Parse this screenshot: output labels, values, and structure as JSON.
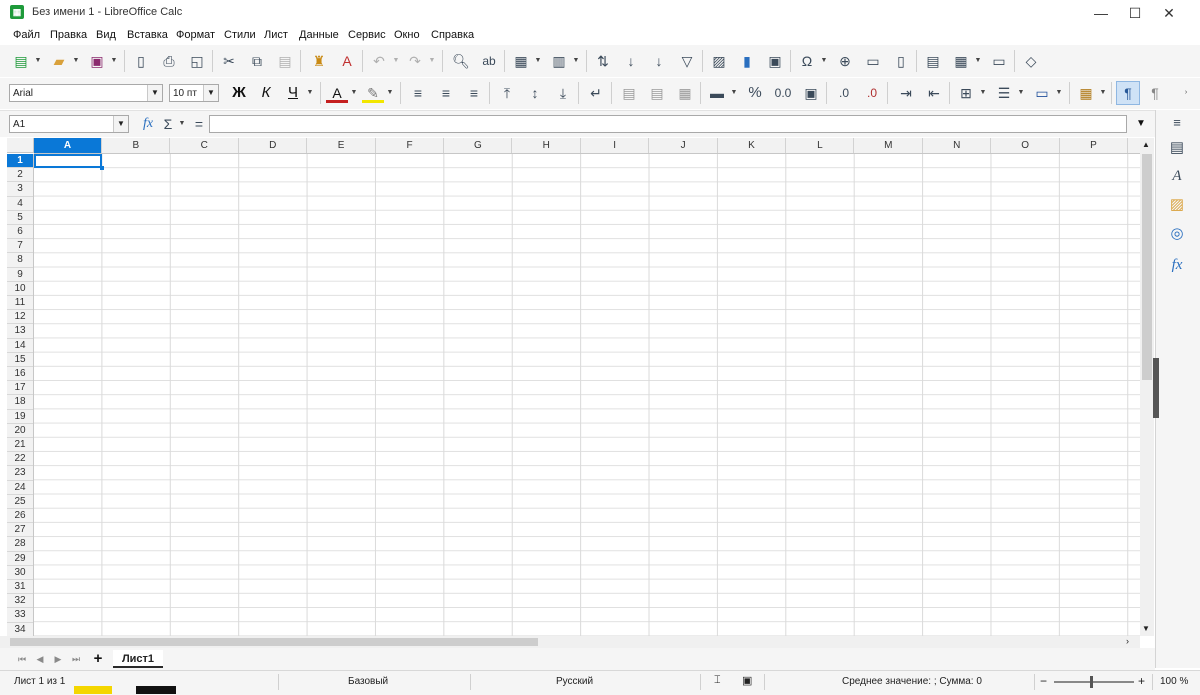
{
  "window": {
    "title": "Без имени 1 - LibreOffice Calc",
    "app_icon": "calc-icon",
    "controls": [
      "minimize-icon",
      "maximize-icon",
      "close-icon"
    ]
  },
  "menu": {
    "items": [
      "Файл",
      "Правка",
      "Вид",
      "Вставка",
      "Формат",
      "Стили",
      "Лист",
      "Данные",
      "Сервис",
      "Окно",
      "Справка"
    ]
  },
  "toolbar": {
    "font_name": "Arial",
    "font_size": "10 пт",
    "bold_label": "Ж",
    "italic_label": "К",
    "underline_label": "Ч",
    "font_color_label": "A",
    "percent_label": "%",
    "number_label": "0.0",
    "add_decimal_label": ".0",
    "remove_decimal_label": ".0"
  },
  "formula_bar": {
    "name_box": "A1",
    "fx_label": "fx",
    "sum_label": "Σ",
    "equals_label": "=",
    "input_value": ""
  },
  "grid": {
    "columns": [
      "A",
      "B",
      "C",
      "D",
      "E",
      "F",
      "G",
      "H",
      "I",
      "J",
      "K",
      "L",
      "M",
      "N",
      "O",
      "P"
    ],
    "rows": [
      "1",
      "2",
      "3",
      "4",
      "5",
      "6",
      "7",
      "8",
      "9",
      "10",
      "11",
      "12",
      "13",
      "14",
      "15",
      "16",
      "17",
      "18",
      "19",
      "20",
      "21",
      "22",
      "23",
      "24",
      "25",
      "26",
      "27",
      "28",
      "29",
      "30",
      "31",
      "32",
      "33",
      "34"
    ],
    "active_cell": "A1",
    "accent_color": "#0a78d7"
  },
  "sheets": {
    "add_label": "+",
    "tabs": [
      "Лист1"
    ]
  },
  "status": {
    "sheet_info": "Лист 1 из 1",
    "page_style": "Базовый",
    "language": "Русский",
    "selection_summary": "Среднее значение: ; Сумма: 0",
    "zoom_minus": "−",
    "zoom_plus": "+",
    "zoom": "100 %"
  },
  "sidebar": {
    "icons": [
      "properties-icon",
      "styles-icon",
      "gallery-icon",
      "navigator-icon",
      "functions-icon"
    ],
    "menu_icon": "hamburger-icon"
  }
}
